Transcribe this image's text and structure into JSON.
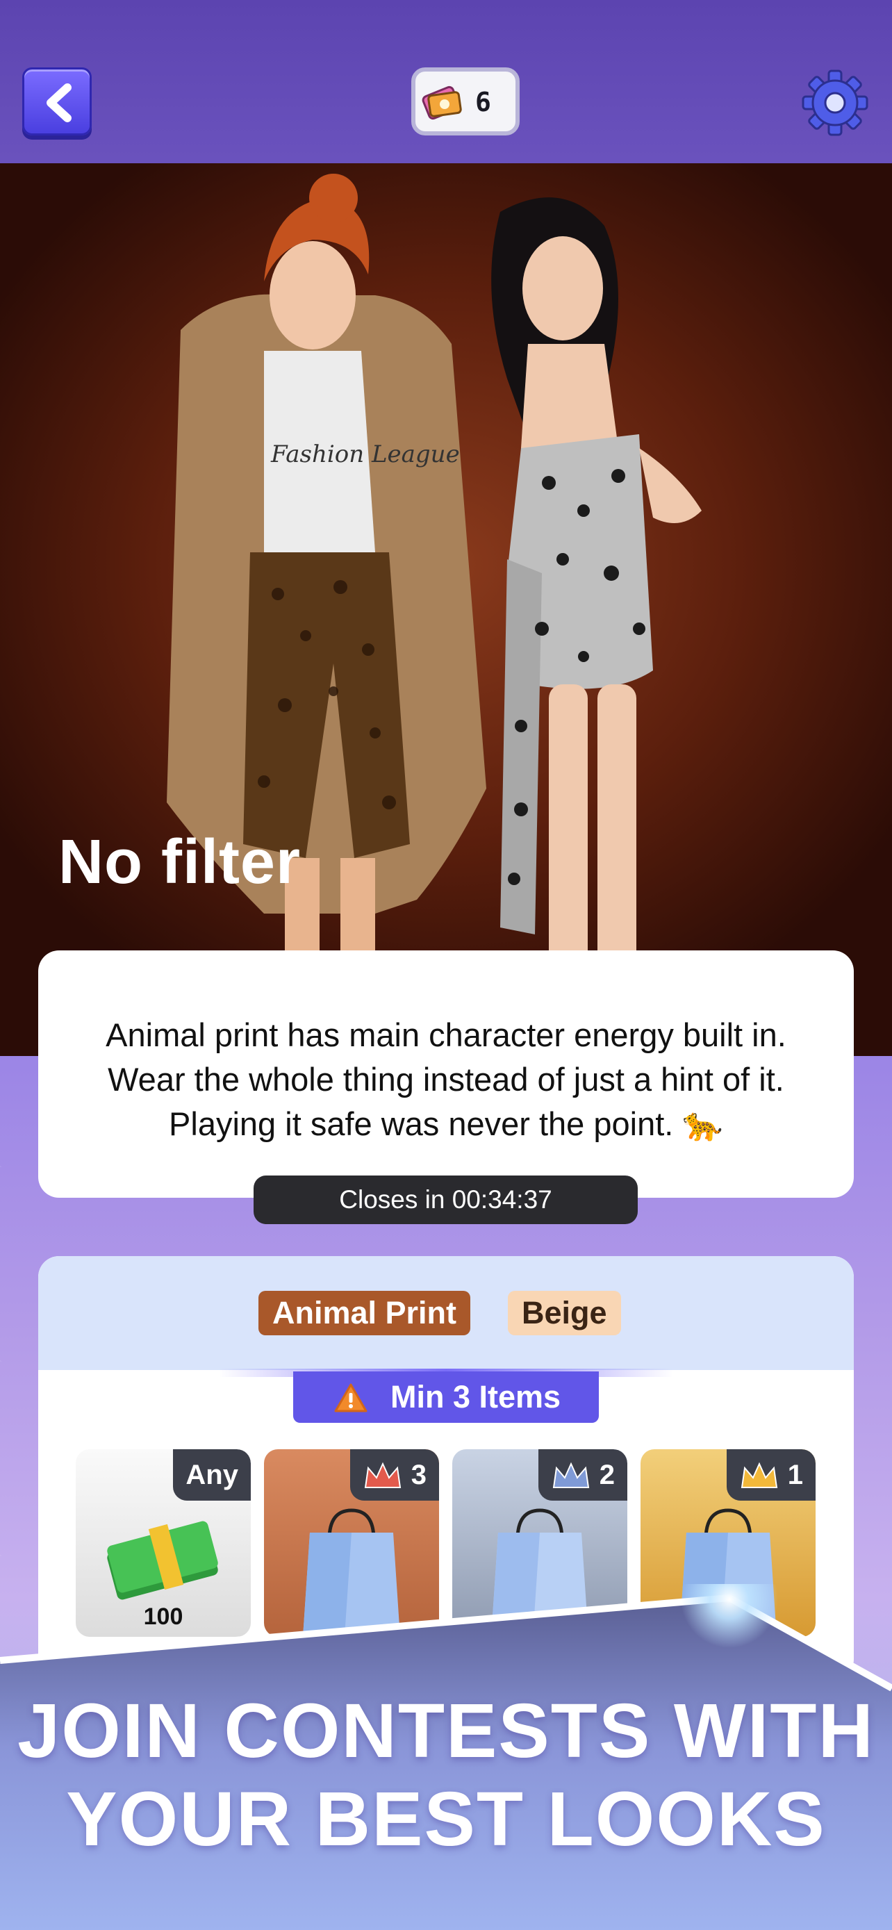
{
  "header": {
    "ticket_count": "6"
  },
  "hero": {
    "title": "No filter",
    "shirt_print": "Fashion League"
  },
  "description": {
    "text": "Animal print has main character energy built in. Wear the whole thing instead of just a hint of it. Playing it safe was never the point. 🐆"
  },
  "timer": {
    "label": "Closes in 00:34:37"
  },
  "contest": {
    "tags": [
      "Animal Print",
      "Beige"
    ],
    "requirement": "Min 3 Items",
    "slots": [
      {
        "badge": "Any",
        "value": "100"
      },
      {
        "badge": "3"
      },
      {
        "badge": "2"
      },
      {
        "badge": "1"
      }
    ]
  },
  "promo": {
    "line1": "JOIN CONTESTS WITH",
    "line2": "YOUR BEST LOOKS"
  },
  "colors": {
    "accent": "#6156e8",
    "tag_animal": "#a9582a",
    "tag_beige": "#f9d6b4",
    "timer_bg": "#2a2a2e"
  }
}
